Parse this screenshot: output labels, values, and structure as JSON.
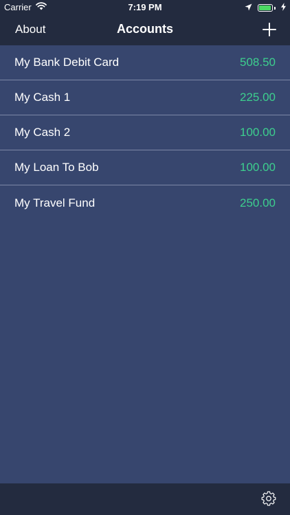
{
  "status_bar": {
    "carrier": "Carrier",
    "time": "7:19 PM",
    "battery_level": 0.95,
    "icons": [
      "wifi-icon",
      "location-arrow-icon",
      "battery-icon",
      "charging-bolt-icon"
    ]
  },
  "nav": {
    "left_label": "About",
    "title": "Accounts",
    "right_icon": "plus-icon"
  },
  "accounts": [
    {
      "name": "My Bank Debit Card",
      "balance": "508.50"
    },
    {
      "name": "My Cash 1",
      "balance": "225.00"
    },
    {
      "name": "My Cash 2",
      "balance": "100.00"
    },
    {
      "name": "My Loan To Bob",
      "balance": "100.00"
    },
    {
      "name": "My Travel Fund",
      "balance": "250.00"
    }
  ],
  "toolbar": {
    "right_icon": "gear-icon"
  },
  "colors": {
    "background": "#37466e",
    "bars": "#232b3f",
    "balance": "#3dcf8e",
    "separator": "#7d88a7"
  }
}
